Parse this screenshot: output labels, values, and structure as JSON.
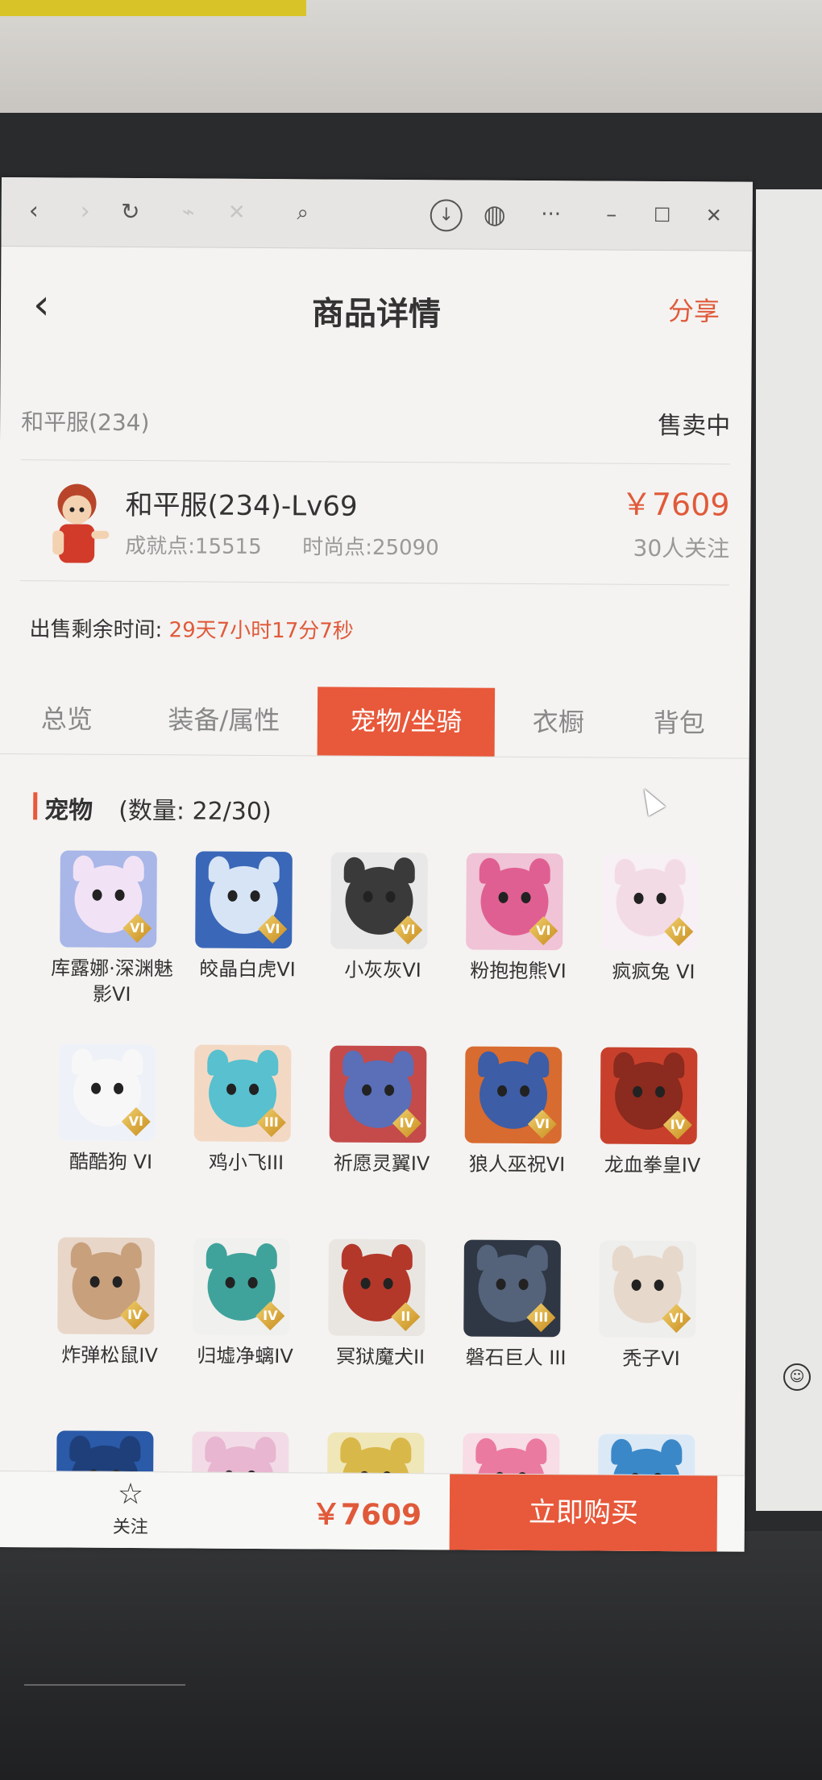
{
  "browser": {
    "icons": [
      "back-arrow-icon",
      "forward-arrow-icon",
      "refresh-icon",
      "link-icon",
      "close-x-icon",
      "search-icon",
      "download-icon",
      "globe-icon",
      "more-icon",
      "minimize-icon",
      "maximize-icon",
      "close-window-icon"
    ]
  },
  "header": {
    "title": "商品详情",
    "share": "分享"
  },
  "server": {
    "name": "和平服(234)",
    "status": "售卖中"
  },
  "product": {
    "name": "和平服(234)-Lv69",
    "achievement": "成就点:15515",
    "fashion": "时尚点:25090",
    "price": "￥7609",
    "followers": "30人关注"
  },
  "timer": {
    "label": "出售剩余时间:",
    "value": "29天7小时17分7秒"
  },
  "tabs": [
    {
      "label": "总览",
      "active": false
    },
    {
      "label": "装备/属性",
      "active": false
    },
    {
      "label": "宠物/坐骑",
      "active": true
    },
    {
      "label": "衣橱",
      "active": false
    },
    {
      "label": "背包",
      "active": false
    }
  ],
  "section": {
    "name": "宠物",
    "count": "(数量: 22/30)"
  },
  "pets": [
    {
      "name": "库露娜·深渊魅影VI",
      "badge": "VI",
      "color": "#a9b6e8",
      "face": "#f1e3f5"
    },
    {
      "name": "皎晶白虎VI",
      "badge": "VI",
      "color": "#3a67b8",
      "face": "#d7e4f6"
    },
    {
      "name": "小灰灰VI",
      "badge": "VI",
      "color": "#e8e8e8",
      "face": "#3a3a3a"
    },
    {
      "name": "粉抱抱熊VI",
      "badge": "VI",
      "color": "#f0c3d6",
      "face": "#e05f92"
    },
    {
      "name": "疯疯兔 VI",
      "badge": "VI",
      "color": "#f7f0f4",
      "face": "#f3dbe6"
    },
    {
      "name": "酷酷狗 VI",
      "badge": "VI",
      "color": "#eef2f8",
      "face": "#f7f7f7"
    },
    {
      "name": "鸡小飞III",
      "badge": "III",
      "color": "#f3d9c4",
      "face": "#58c0cf"
    },
    {
      "name": "祈愿灵翼IV",
      "badge": "IV",
      "color": "#c54a4a",
      "face": "#5a6fb8"
    },
    {
      "name": "狼人巫祝VI",
      "badge": "VI",
      "color": "#d86b2f",
      "face": "#3d5da6"
    },
    {
      "name": "龙血拳皇IV",
      "badge": "IV",
      "color": "#c8402c",
      "face": "#8b2a1e"
    },
    {
      "name": "炸弹松鼠IV",
      "badge": "IV",
      "color": "#e8d6c8",
      "face": "#c8a07c"
    },
    {
      "name": "归墟净螭IV",
      "badge": "IV",
      "color": "#f0f0ee",
      "face": "#3fa39b"
    },
    {
      "name": "冥狱魔犬II",
      "badge": "II",
      "color": "#e9e6e2",
      "face": "#b4382a"
    },
    {
      "name": "磐石巨人 III",
      "badge": "III",
      "color": "#2f3744",
      "face": "#54627a"
    },
    {
      "name": "秃子VI",
      "badge": "VI",
      "color": "#eeeeec",
      "face": "#e7d8cc"
    },
    {
      "name": "",
      "badge": "",
      "color": "#2a5aa8",
      "face": "#1f3f7a"
    },
    {
      "name": "",
      "badge": "",
      "color": "#f2dbe6",
      "face": "#e8b6d0"
    },
    {
      "name": "",
      "badge": "",
      "color": "#f0e7b8",
      "face": "#d9b84a"
    },
    {
      "name": "",
      "badge": "",
      "color": "#f8dce6",
      "face": "#ea7aa0"
    },
    {
      "name": "",
      "badge": "",
      "color": "#dbe9f6",
      "face": "#3b88c9"
    }
  ],
  "bottom": {
    "follow": "关注",
    "price": "￥7609",
    "buy": "立即购买"
  }
}
